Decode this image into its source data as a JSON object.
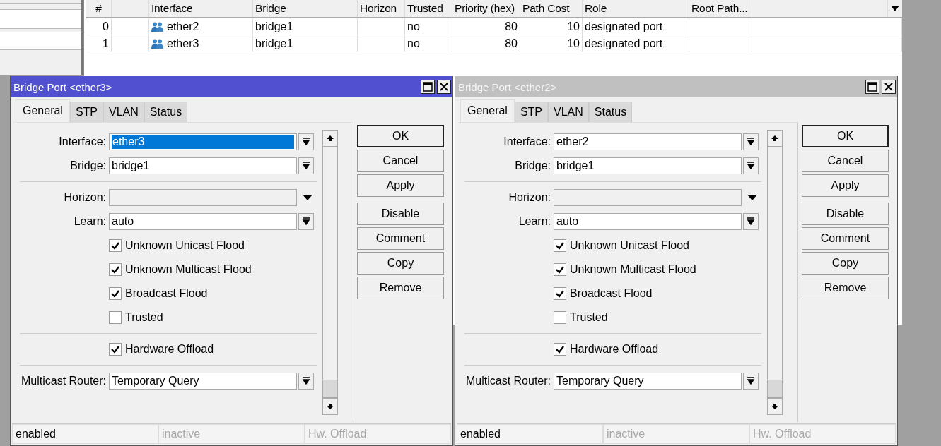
{
  "table": {
    "columns": [
      {
        "label": "#"
      },
      {},
      {
        "label": "Interface"
      },
      {
        "label": "Bridge"
      },
      {
        "label": "Horizon"
      },
      {
        "label": "Trusted"
      },
      {
        "label": "Priority (hex)"
      },
      {
        "label": "Path Cost"
      },
      {
        "label": "Role"
      },
      {
        "label": "Root Path..."
      }
    ],
    "rows": [
      {
        "cells": [
          "0",
          null,
          "ether2",
          "bridge1",
          null,
          "no",
          "80",
          "10",
          "designated port",
          null
        ]
      },
      {
        "cells": [
          "1",
          null,
          "ether3",
          "bridge1",
          null,
          "no",
          "80",
          "10",
          "designated port",
          null
        ]
      }
    ]
  },
  "dialogs": [
    {
      "title": "Bridge Port <ether3>",
      "active": true,
      "tabs": [
        {
          "label": "General",
          "selected": true
        },
        {
          "label": "STP",
          "selected": false
        },
        {
          "label": "VLAN",
          "selected": false
        },
        {
          "label": "Status",
          "selected": false
        }
      ],
      "fields": [
        {
          "kind": "select",
          "label": "Interface:",
          "value": "ether3",
          "highlighted": true
        },
        {
          "kind": "select",
          "label": "Bridge:",
          "value": "bridge1",
          "highlighted": false
        },
        {
          "kind": "separator"
        },
        {
          "kind": "combo",
          "label": "Horizon:",
          "disabled": true
        },
        {
          "kind": "select",
          "label": "Learn:",
          "value": "auto",
          "highlighted": false
        },
        {
          "kind": "checkbox",
          "label": "Unknown Unicast Flood",
          "checked": true
        },
        {
          "kind": "checkbox",
          "label": "Unknown Multicast Flood",
          "checked": true
        },
        {
          "kind": "checkbox",
          "label": "Broadcast Flood",
          "checked": true
        },
        {
          "kind": "checkbox",
          "label": "Trusted",
          "checked": false
        },
        {
          "kind": "separator"
        },
        {
          "kind": "checkbox",
          "label": "Hardware Offload",
          "checked": true
        },
        {
          "kind": "separator"
        },
        {
          "kind": "select",
          "label": "Multicast Router:",
          "value": "Temporary Query",
          "highlighted": false
        }
      ],
      "button_groups": [
        [
          {
            "label": "OK",
            "default": true
          },
          {
            "label": "Cancel",
            "default": false
          },
          {
            "label": "Apply",
            "default": false
          }
        ],
        [
          {
            "label": "Disable",
            "default": false
          },
          {
            "label": "Comment",
            "default": false
          },
          {
            "label": "Copy",
            "default": false
          },
          {
            "label": "Remove",
            "default": false
          }
        ]
      ],
      "status": [
        {
          "text": "enabled",
          "dimmed": false
        },
        {
          "text": "inactive",
          "dimmed": true
        },
        {
          "text": "Hw. Offload",
          "dimmed": true
        }
      ]
    },
    {
      "title": "Bridge Port <ether2>",
      "active": false,
      "tabs": [
        {
          "label": "General",
          "selected": true
        },
        {
          "label": "STP",
          "selected": false
        },
        {
          "label": "VLAN",
          "selected": false
        },
        {
          "label": "Status",
          "selected": false
        }
      ],
      "fields": [
        {
          "kind": "select",
          "label": "Interface:",
          "value": "ether2",
          "highlighted": false
        },
        {
          "kind": "select",
          "label": "Bridge:",
          "value": "bridge1",
          "highlighted": false
        },
        {
          "kind": "separator"
        },
        {
          "kind": "combo",
          "label": "Horizon:",
          "disabled": true
        },
        {
          "kind": "select",
          "label": "Learn:",
          "value": "auto",
          "highlighted": false
        },
        {
          "kind": "checkbox",
          "label": "Unknown Unicast Flood",
          "checked": true
        },
        {
          "kind": "checkbox",
          "label": "Unknown Multicast Flood",
          "checked": true
        },
        {
          "kind": "checkbox",
          "label": "Broadcast Flood",
          "checked": true
        },
        {
          "kind": "checkbox",
          "label": "Trusted",
          "checked": false
        },
        {
          "kind": "separator"
        },
        {
          "kind": "checkbox",
          "label": "Hardware Offload",
          "checked": true
        },
        {
          "kind": "separator"
        },
        {
          "kind": "select",
          "label": "Multicast Router:",
          "value": "Temporary Query",
          "highlighted": false
        }
      ],
      "button_groups": [
        [
          {
            "label": "OK",
            "default": true
          },
          {
            "label": "Cancel",
            "default": false
          },
          {
            "label": "Apply",
            "default": false
          }
        ],
        [
          {
            "label": "Disable",
            "default": false
          },
          {
            "label": "Comment",
            "default": false
          },
          {
            "label": "Copy",
            "default": false
          },
          {
            "label": "Remove",
            "default": false
          }
        ]
      ],
      "status": [
        {
          "text": "enabled",
          "dimmed": false
        },
        {
          "text": "inactive",
          "dimmed": true
        },
        {
          "text": "Hw. Offload",
          "dimmed": true
        }
      ]
    }
  ]
}
